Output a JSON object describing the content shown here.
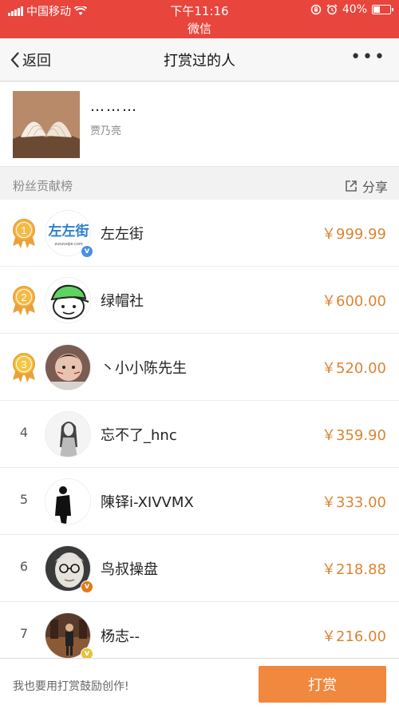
{
  "status_bar": {
    "carrier": "中国移动",
    "time": "下午11:16",
    "app": "微信",
    "battery": "40%",
    "battery_level": 0.4
  },
  "nav": {
    "back_label": "返回",
    "title": "打赏过的人"
  },
  "article": {
    "title": "………",
    "author": "贾乃亮"
  },
  "section": {
    "label": "粉丝贡献榜",
    "share_label": "分享"
  },
  "rankings": [
    {
      "rank": "1",
      "name": "左左街",
      "amount": "￥999.99",
      "medal": "gold",
      "avatar_text": "左左街",
      "avatar_sub": "zuozuojie.com",
      "verified": "blue"
    },
    {
      "rank": "2",
      "name": "绿帽社",
      "amount": "￥600.00",
      "medal": "gold",
      "verified": ""
    },
    {
      "rank": "3",
      "name": "丶小小陈先生",
      "amount": "￥520.00",
      "medal": "gold",
      "verified": ""
    },
    {
      "rank": "4",
      "name": "忘不了_hnc",
      "amount": "￥359.90",
      "medal": "",
      "verified": ""
    },
    {
      "rank": "5",
      "name": "陳铎i-XIVVMX",
      "amount": "￥333.00",
      "medal": "",
      "verified": ""
    },
    {
      "rank": "6",
      "name": "鸟叔操盘",
      "amount": "￥218.88",
      "medal": "",
      "verified": "orange"
    },
    {
      "rank": "7",
      "name": "杨志--",
      "amount": "￥216.00",
      "medal": "",
      "verified": "yellow"
    }
  ],
  "bottom": {
    "hint": "我也要用打赏鼓励创作!",
    "button_label": "打赏"
  },
  "colors": {
    "status_bg": "#e8453c",
    "amount": "#d98533",
    "button": "#f0883d",
    "medal": "#e9a23b"
  }
}
